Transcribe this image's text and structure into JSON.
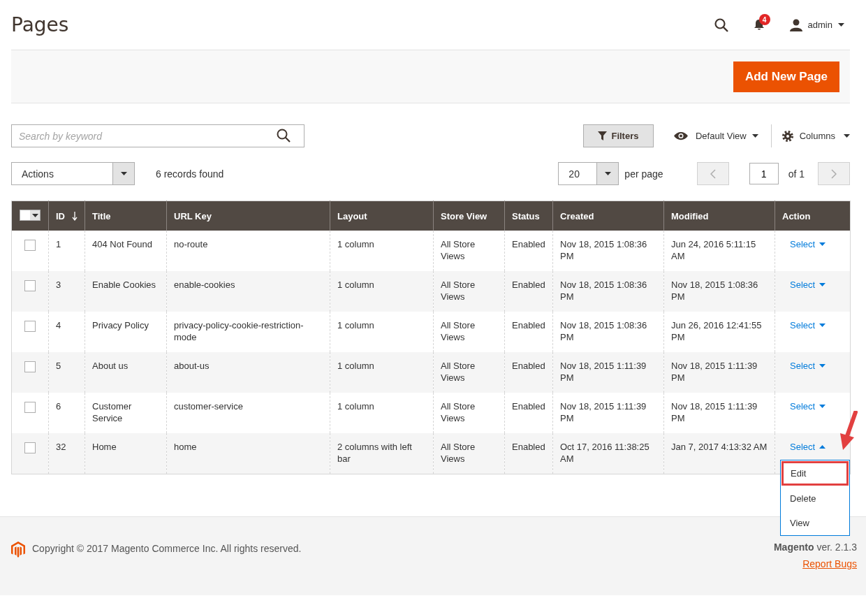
{
  "page": {
    "title": "Pages"
  },
  "header": {
    "notifications": "4",
    "user": "admin"
  },
  "add_button": "Add New Page",
  "search": {
    "placeholder": "Search by keyword"
  },
  "toolbar": {
    "filters": "Filters",
    "view": "Default View",
    "columns": "Columns"
  },
  "actions": {
    "value": "Actions"
  },
  "records": "6 records found",
  "pager": {
    "per_page_value": "20",
    "per_page_label": "per page",
    "page": "1",
    "of": "of 1"
  },
  "table": {
    "columns": [
      "ID",
      "Title",
      "URL Key",
      "Layout",
      "Store View",
      "Status",
      "Created",
      "Modified",
      "Action"
    ],
    "rows": [
      {
        "checked": false,
        "id": "1",
        "title": "404 Not Found",
        "url_key": "no-route",
        "layout": "1 column",
        "store_view": "All Store Views",
        "status": "Enabled",
        "created": "Nov 18, 2015 1:08:36 PM",
        "modified": "Jun 24, 2016 5:11:15 AM",
        "action": "Select",
        "expanded": false
      },
      {
        "checked": false,
        "id": "3",
        "title": "Enable Cookies",
        "url_key": "enable-cookies",
        "layout": "1 column",
        "store_view": "All Store Views",
        "status": "Enabled",
        "created": "Nov 18, 2015 1:08:36 PM",
        "modified": "Nov 18, 2015 1:08:36 PM",
        "action": "Select",
        "expanded": false
      },
      {
        "checked": false,
        "id": "4",
        "title": "Privacy Policy",
        "url_key": "privacy-policy-cookie-restriction-mode",
        "layout": "1 column",
        "store_view": "All Store Views",
        "status": "Enabled",
        "created": "Nov 18, 2015 1:08:36 PM",
        "modified": "Jun 26, 2016 12:41:55 PM",
        "action": "Select",
        "expanded": false
      },
      {
        "checked": false,
        "id": "5",
        "title": "About us",
        "url_key": "about-us",
        "layout": "1 column",
        "store_view": "All Store Views",
        "status": "Enabled",
        "created": "Nov 18, 2015 1:11:39 PM",
        "modified": "Nov 18, 2015 1:11:39 PM",
        "action": "Select",
        "expanded": false
      },
      {
        "checked": false,
        "id": "6",
        "title": "Customer Service",
        "url_key": "customer-service",
        "layout": "1 column",
        "store_view": "All Store Views",
        "status": "Enabled",
        "created": "Nov 18, 2015 1:11:39 PM",
        "modified": "Nov 18, 2015 1:11:39 PM",
        "action": "Select",
        "expanded": false
      },
      {
        "checked": false,
        "id": "32",
        "title": "Home",
        "url_key": "home",
        "layout": "2 columns with left bar",
        "store_view": "All Store Views",
        "status": "Enabled",
        "created": "Oct 17, 2016 11:38:25 AM",
        "modified": "Jan 7, 2017 4:13:32 AM",
        "action": "Select",
        "expanded": true,
        "menu": [
          {
            "label": "Edit",
            "highlighted": true
          },
          {
            "label": "Delete",
            "highlighted": false
          },
          {
            "label": "View",
            "highlighted": false
          }
        ]
      }
    ]
  },
  "footer": {
    "copyright": "Copyright © 2017 Magento Commerce Inc. All rights reserved.",
    "version": "**Magento** ver. 2.1.3",
    "report": "Report Bugs"
  }
}
